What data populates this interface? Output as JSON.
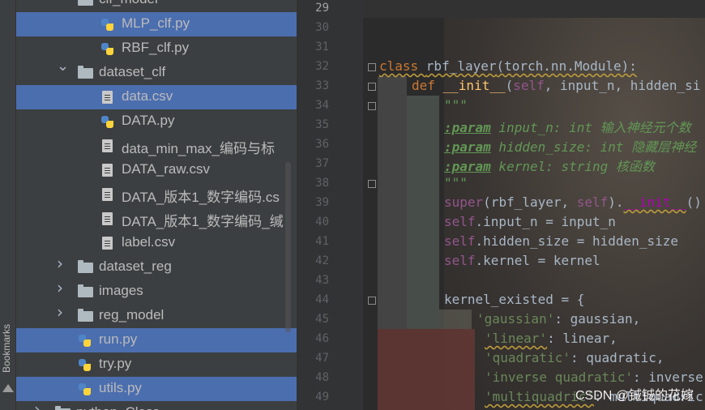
{
  "sidebar": {
    "bookmarks_label": "Bookmarks"
  },
  "tree": {
    "items": [
      {
        "label": "clf_model",
        "kind": "folder",
        "depth": 1,
        "arrow": "v"
      },
      {
        "label": "MLP_clf.py",
        "kind": "py",
        "depth": 2,
        "selected": true
      },
      {
        "label": "RBF_clf.py",
        "kind": "py",
        "depth": 2
      },
      {
        "label": "dataset_clf",
        "kind": "folder",
        "depth": 1,
        "arrow": "v"
      },
      {
        "label": "data.csv",
        "kind": "file",
        "depth": 2,
        "selected": true
      },
      {
        "label": "DATA.py",
        "kind": "py",
        "depth": 2
      },
      {
        "label": "data_min_max_编码与标",
        "kind": "file",
        "depth": 2
      },
      {
        "label": "DATA_raw.csv",
        "kind": "file",
        "depth": 2
      },
      {
        "label": "DATA_版本1_数字编码.cs",
        "kind": "file",
        "depth": 2
      },
      {
        "label": "DATA_版本1_数字编码_缄",
        "kind": "file",
        "depth": 2
      },
      {
        "label": "label.csv",
        "kind": "file",
        "depth": 2
      },
      {
        "label": "dataset_reg",
        "kind": "folder",
        "depth": 1,
        "arrow": ">"
      },
      {
        "label": "images",
        "kind": "folder",
        "depth": 1,
        "arrow": ">"
      },
      {
        "label": "reg_model",
        "kind": "folder",
        "depth": 1,
        "arrow": ">"
      },
      {
        "label": "run.py",
        "kind": "py",
        "depth": 1,
        "selected": true
      },
      {
        "label": "try.py",
        "kind": "py",
        "depth": 1
      },
      {
        "label": "utils.py",
        "kind": "py",
        "depth": 1,
        "selected": true
      },
      {
        "label": "python_Class",
        "kind": "folder",
        "depth": 0,
        "arrow": ">"
      }
    ]
  },
  "editor": {
    "line_numbers": [
      "29",
      "30",
      "31",
      "32",
      "33",
      "34",
      "35",
      "36",
      "37",
      "38",
      "39",
      "40",
      "41",
      "42",
      "43",
      "44",
      "45",
      "46",
      "47",
      "48",
      "49"
    ],
    "code": {
      "l32_kw": "class ",
      "l32_name": "rbf_layer",
      "l32_rest": "(torch.nn.Module):",
      "l33_kw": "def ",
      "l33_name": "__init__",
      "l33_p1": "(",
      "l33_self": "self",
      "l33_rest": ", input_n, hidden_si",
      "l34": "\"\"\"",
      "l35_tag": ":param",
      "l35_rest": " input_n: int 输入神经元个数",
      "l36_tag": ":param",
      "l36_rest": " hidden_size: int 隐藏层神经",
      "l37_tag": ":param",
      "l37_rest": " kernel: string 核函数",
      "l38": "\"\"\"",
      "l39_super": "super",
      "l39_a": "(rbf_layer, ",
      "l39_self": "self",
      "l39_b": ").",
      "l39_init": "__init__",
      "l39_c": "()",
      "l40_self": "self",
      "l40_rest": ".input_n = input_n",
      "l41_self": "self",
      "l41_rest": ".hidden_size = hidden_size",
      "l42_self": "self",
      "l42_rest": ".kernel = kernel",
      "l44": "kernel_existed = {",
      "l45_key": "'gaussian'",
      "l45_rest": ": gaussian,",
      "l46_key": "'linear'",
      "l46_rest": ": linear,",
      "l47_key": "'quadratic'",
      "l47_rest": ": quadratic,",
      "l48_key": "'inverse quadratic'",
      "l48_rest": ": inverse",
      "l49_key": "'multiquadric'",
      "l49_rest": ": multiquadric"
    }
  },
  "watermark": "CSDN @铖铖的花嫁",
  "colors": {
    "selection": "#4b6eaf",
    "keyword": "#cc7832",
    "function": "#ffc66d",
    "string": "#6a8759",
    "self": "#94558d"
  }
}
